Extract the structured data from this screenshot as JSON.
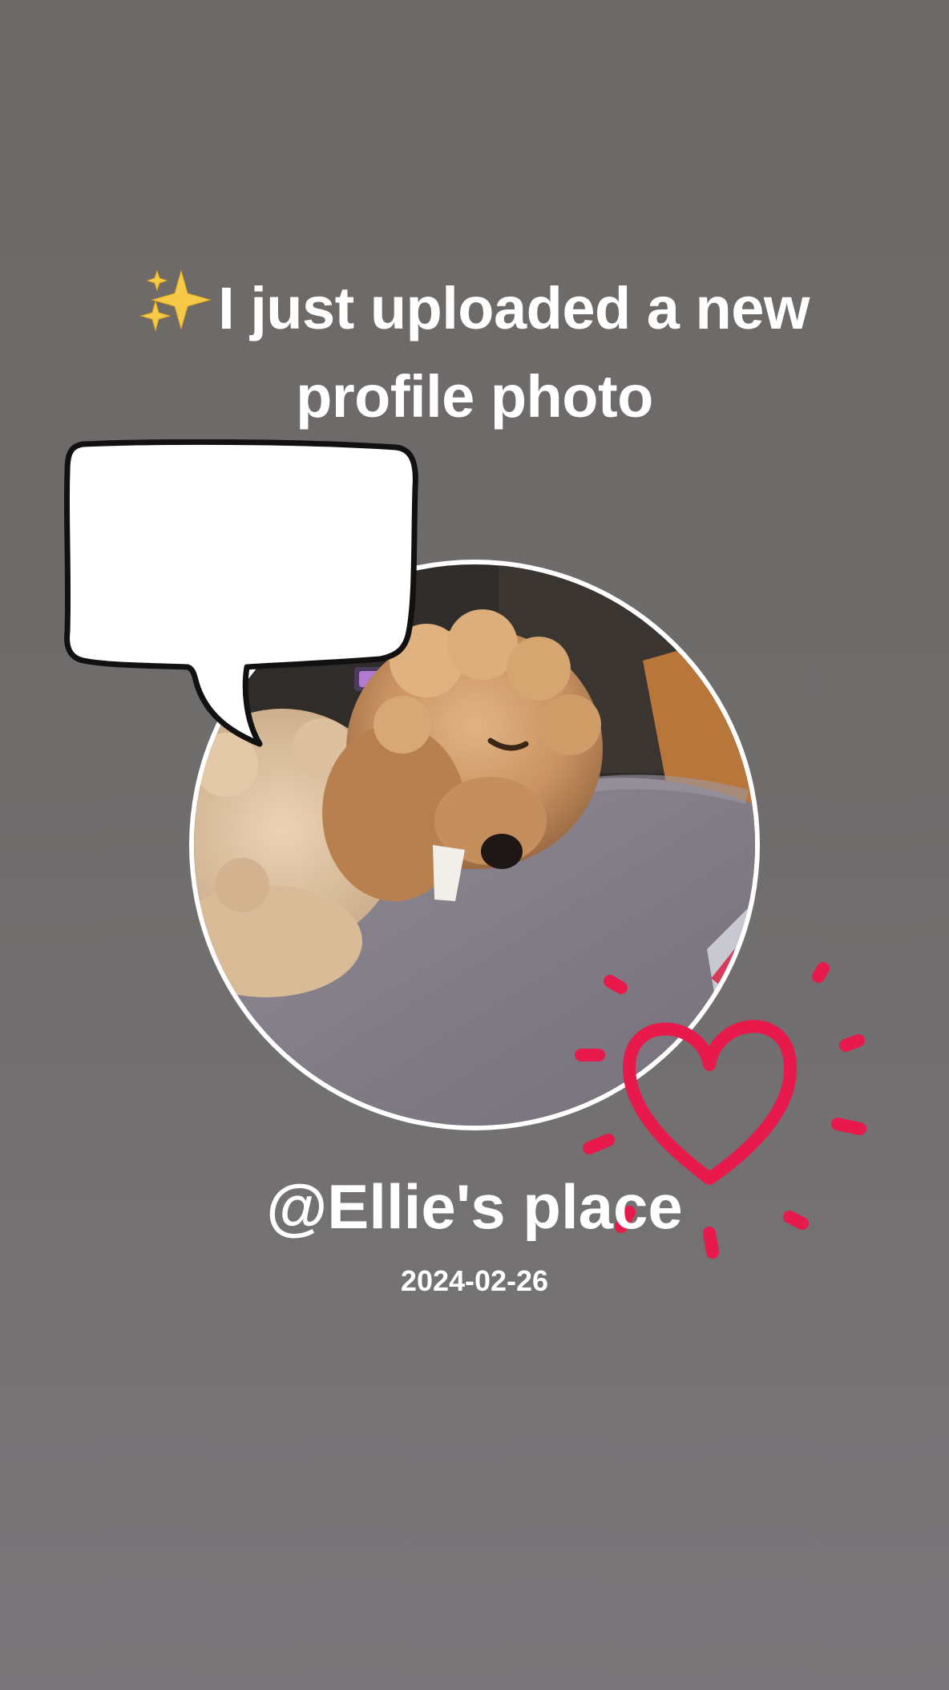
{
  "story": {
    "headline": "I just uploaded a new profile photo",
    "headline_emoji": "sparkles-emoji",
    "username": "@Ellie's place",
    "date": "2024-02-26"
  },
  "photo": {
    "subject": "profile-photo"
  },
  "stickers": {
    "speech_bubble": "speech-bubble-sticker",
    "heart": "heart-doodle-sticker"
  },
  "colors": {
    "background_top": "#6c6866",
    "background_bottom": "#797679",
    "text": "#ffffff",
    "heart": "#e8194b",
    "sparkle": "#f7c948"
  }
}
